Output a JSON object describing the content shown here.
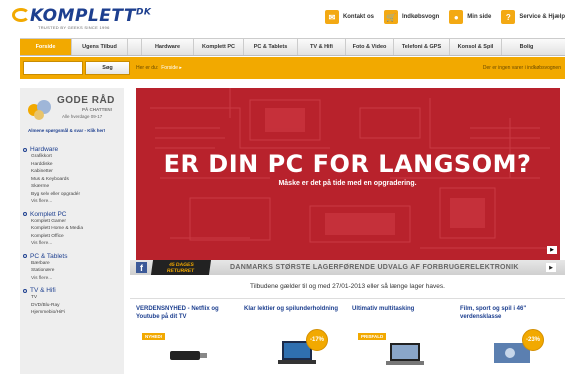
{
  "header": {
    "logo_text": "KOMPLETT",
    "logo_suffix": "DK",
    "tagline": "TRUSTED BY GEEKS SINCE 1996",
    "top_links": [
      {
        "label": "Kontakt os",
        "icon": "envelope-icon"
      },
      {
        "label": "Indkøbsvogn",
        "icon": "cart-icon"
      },
      {
        "label": "Min side",
        "icon": "person-icon"
      },
      {
        "label": "Service & Hjælp",
        "icon": "help-icon"
      }
    ]
  },
  "nav": {
    "tabs_left": [
      "Forside",
      "Ugens Tilbud"
    ],
    "tabs_right": [
      "Hardware",
      "Komplett PC",
      "PC & Tablets",
      "TV & Hifi",
      "Foto & Video",
      "Telefoni & GPS",
      "Konsol & Spil",
      "Bolig"
    ]
  },
  "search": {
    "placeholder": "",
    "button": "Søg"
  },
  "breadcrumb": {
    "label": "Her er du:",
    "current": "Forside"
  },
  "cart_message": "Der er ingen varer i indkøbsvognen",
  "sidebar": {
    "advice_title": "GODE RÅD",
    "advice_sub": "PÅ CHATTEN!",
    "advice_hours": "Alle hverdage 09-17",
    "advice_link": "Almene spørgsmål & svar - Klik her!",
    "categories": [
      {
        "title": "Hardware",
        "items": [
          "Grafikkort",
          "Harddiske",
          "Kabinetter",
          "Mus & Keyboards",
          "Skærme",
          "Byg selv eller opgradér",
          "Vis flere..."
        ]
      },
      {
        "title": "Komplett PC",
        "items": [
          "Komplett Gamer",
          "Komplett Home & Media",
          "Komplett Office",
          "Vis flere..."
        ]
      },
      {
        "title": "PC & Tablets",
        "items": [
          "Bærbare",
          "Stationære",
          "Vis flere..."
        ]
      },
      {
        "title": "TV & Hifi",
        "items": [
          "TV",
          "DVD/Blu-Ray",
          "Hjemmebio/HiFi"
        ]
      }
    ]
  },
  "banner": {
    "headline": "ER DIN PC FOR LANGSOM?",
    "subline": "Måske er det på tide med en opgradering.",
    "bg_color": "#b8222c"
  },
  "strip": {
    "badge_line1": "45 DAGES",
    "badge_line2": "RETURRET",
    "text": "DANMARKS STØRSTE LAGERFØRENDE UDVALG AF FORBRUGERELEKTRONIK"
  },
  "notice": "Tilbudene gælder til og med 27/01-2013 eller så længe lager haves.",
  "products": [
    {
      "title": "VERDENSNYHED - Netflix og Youtube på dit TV",
      "ribbon": "NYHED!",
      "discount": ""
    },
    {
      "title": "Klar lektier og spilunderholdning",
      "ribbon": "",
      "discount": "-17%"
    },
    {
      "title": "Ultimativ multitasking",
      "ribbon": "PRISFALD",
      "discount": ""
    },
    {
      "title": "Film, sport og spil i 46\" verdensklasse",
      "ribbon": "",
      "discount": "-23%"
    }
  ],
  "colors": {
    "accent": "#f2a900",
    "brand": "#1d3f8f",
    "banner": "#b8222c"
  }
}
